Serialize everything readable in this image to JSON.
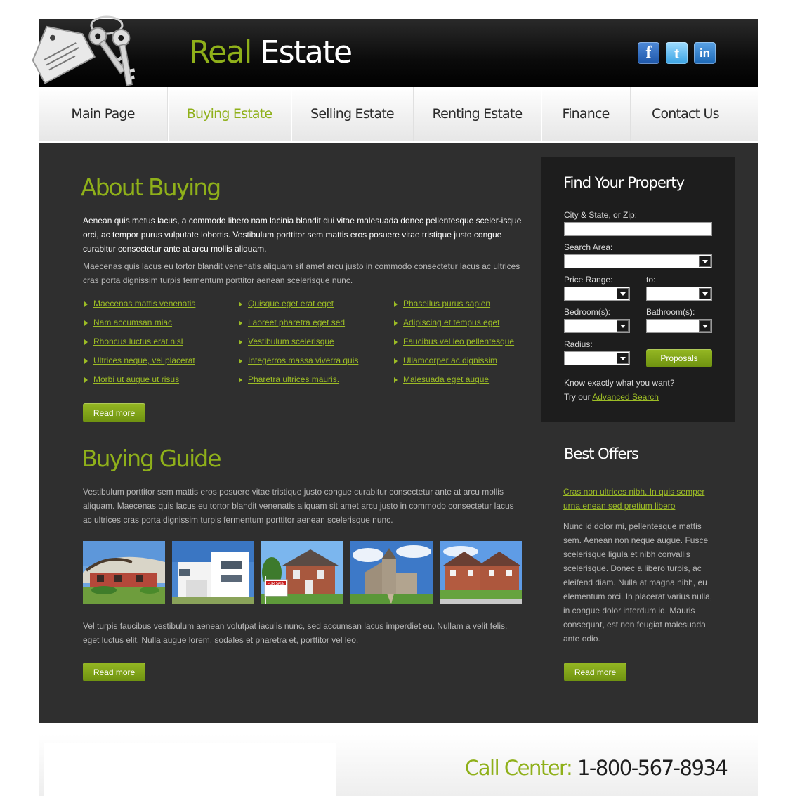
{
  "brand": {
    "word1": "Real",
    "word2": "Estate"
  },
  "social": [
    {
      "label": "f",
      "icon": "facebook-icon"
    },
    {
      "label": "t",
      "icon": "twitter-icon"
    },
    {
      "label": "in",
      "icon": "linkedin-icon"
    }
  ],
  "nav": [
    "Main Page",
    "Buying Estate",
    "Selling Estate",
    "Renting Estate",
    "Finance",
    "Contact Us"
  ],
  "nav_active_index": 1,
  "about": {
    "title": "About Buying",
    "intro": "Aenean quis metus lacus, a commodo libero nam lacinia blandit dui vitae malesuada donec pellentesque sceler-isque orci, ac tempor purus vulputate lobortis. Vestibulum porttitor sem mattis eros posuere vitae tristique justo congue curabitur consectetur ante at arcu mollis aliquam.",
    "text": "Maecenas quis lacus eu tortor blandit venenatis aliquam sit amet arcu justo in commodo consectetur lacus ac ultrices cras porta dignissim turpis fermentum porttitor aenean scelerisque nunc.",
    "links": [
      [
        "Maecenas mattis venenatis",
        "Nam accumsan miac",
        "Rhoncus luctus erat nisl",
        "Ultrices neque, vel placerat",
        "Morbi ut augue ut risus"
      ],
      [
        "Quisque eget erat eget",
        "Laoreet pharetra eget sed",
        "Vestibulum scelerisque",
        "Integerros massa viverra quis",
        "Pharetra ultrices mauris."
      ],
      [
        "Phasellus purus sapien",
        "Adipiscing et tempus eget",
        "Faucibus vel leo pellentesque",
        "Ullamcorper ac dignissim",
        "Malesuada eget augue"
      ]
    ],
    "read_more": "Read more"
  },
  "guide": {
    "title": "Buying Guide",
    "text1": "Vestibulum porttitor sem mattis eros posuere vitae tristique justo congue curabitur consectetur ante at arcu mollis aliquam. Maecenas quis lacus eu tortor blandit venenatis aliquam sit amet arcu justo in commodo consectetur lacus ac ultrices cras porta dignissim turpis fermentum porttitor aenean scelerisque nunc.",
    "text2": "Vel turpis faucibus vestibulum aenean volutpat iaculis nunc, sed accumsan lacus imperdiet eu. Nullam a velit felis, eget luctus elit. Nulla augue lorem, sodales et pharetra et, porttitor vel leo.",
    "read_more": "Read more",
    "sign_text": "FOR SALE"
  },
  "search": {
    "title": "Find Your Property",
    "city_label": "City & State, or Zip:",
    "area_label": "Search Area:",
    "price_label": "Price Range:",
    "to_label": "to:",
    "bed_label": "Bedroom(s):",
    "bath_label": "Bathroom(s):",
    "radius_label": "Radius:",
    "button": "Proposals",
    "know_text": "Know exactly what you want?",
    "try_text": "Try our",
    "advanced_link": "Advanced Search"
  },
  "offers": {
    "title": "Best Offers",
    "link": "Cras non ultrices nibh. In quis semper urna enean sed pretium libero",
    "text": "Nunc id dolor mi, pellentesque mattis sem. Aenean non neque augue. Fusce scelerisque ligula et nibh convallis scelerisque. Donec a libero turpis, ac eleifend diam. Nulla at magna nibh, eu elementum orci. In placerat varius nulla, in congue dolor interdum id. Mauris consequat, est non feugiat malesuada ante odio.",
    "read_more": "Read more"
  },
  "footer": {
    "label": "Call Center:",
    "phone": "1-800-567-8934"
  },
  "colors": {
    "accent": "#8fb01a",
    "panel": "#2f2f2f",
    "header": "#000000"
  }
}
